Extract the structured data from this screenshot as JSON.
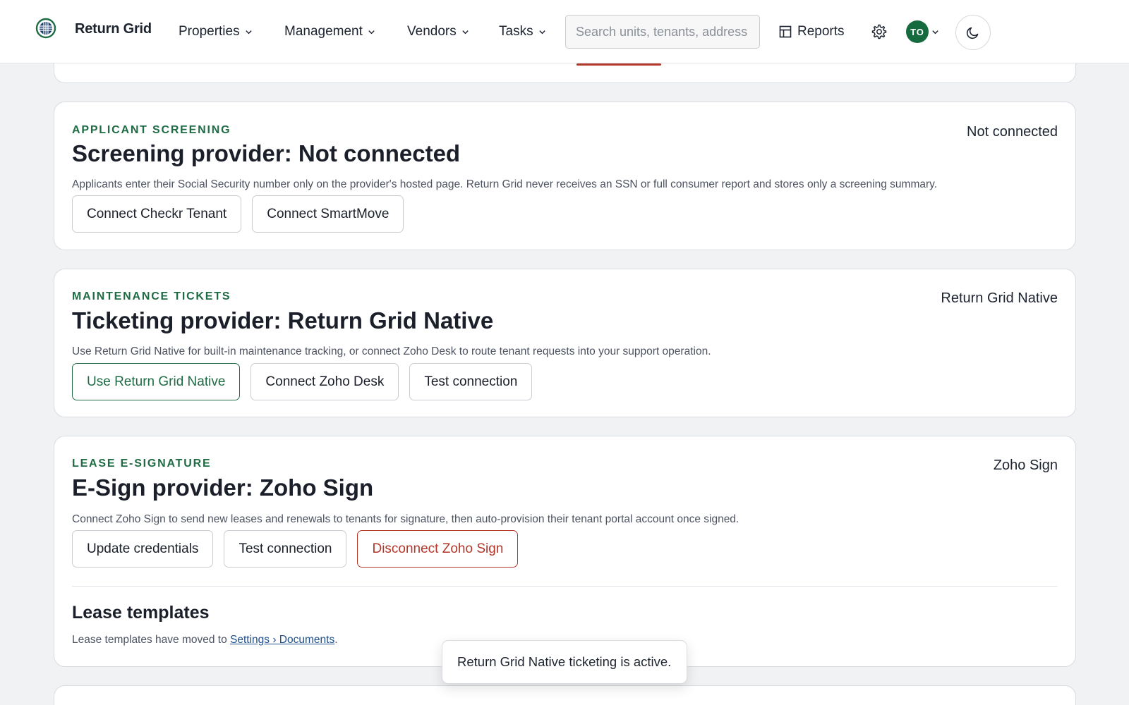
{
  "app": {
    "brand": "Return Grid"
  },
  "nav": {
    "items": [
      {
        "label": "Properties"
      },
      {
        "label": "Management"
      },
      {
        "label": "Vendors"
      },
      {
        "label": "Tasks"
      }
    ],
    "search_placeholder": "Search units, tenants, address",
    "reports_label": "Reports",
    "avatar_initials": "TO"
  },
  "cards": {
    "screening": {
      "eyebrow": "APPLICANT SCREENING",
      "title": "Screening provider: Not connected",
      "status": "Not connected",
      "description": "Applicants enter their Social Security number only on the provider's hosted page. Return Grid never receives an SSN or full consumer report and stores only a screening summary.",
      "buttons": [
        "Connect Checkr Tenant",
        "Connect SmartMove"
      ]
    },
    "maintenance": {
      "eyebrow": "MAINTENANCE TICKETS",
      "title": "Ticketing provider: Return Grid Native",
      "status": "Return Grid Native",
      "description": "Use Return Grid Native for built-in maintenance tracking, or connect Zoho Desk to route tenant requests into your support operation.",
      "buttons": [
        "Use Return Grid Native",
        "Connect Zoho Desk",
        "Test connection"
      ]
    },
    "esign": {
      "eyebrow": "LEASE E-SIGNATURE",
      "title": "E-Sign provider: Zoho Sign",
      "status": "Zoho Sign",
      "description": "Connect Zoho Sign to send new leases and renewals to tenants for signature, then auto-provision their tenant portal account once signed.",
      "buttons": [
        "Update credentials",
        "Test connection",
        "Disconnect Zoho Sign"
      ],
      "templates_title": "Lease templates",
      "templates_desc_prefix": "Lease templates have moved to ",
      "templates_link": "Settings › Documents",
      "templates_desc_suffix": "."
    }
  },
  "toast": {
    "message": "Return Grid Native ticketing is active."
  },
  "colors": {
    "accent_green": "#1f6b44",
    "danger_red": "#b3362a",
    "avatar_green": "#166b3e",
    "page_bg": "#f1f2f4"
  },
  "icons": {
    "logo": "globe-grid-icon",
    "chevron": "chevron-down-icon",
    "reports": "table-icon",
    "settings": "gear-icon",
    "theme": "moon-icon"
  }
}
